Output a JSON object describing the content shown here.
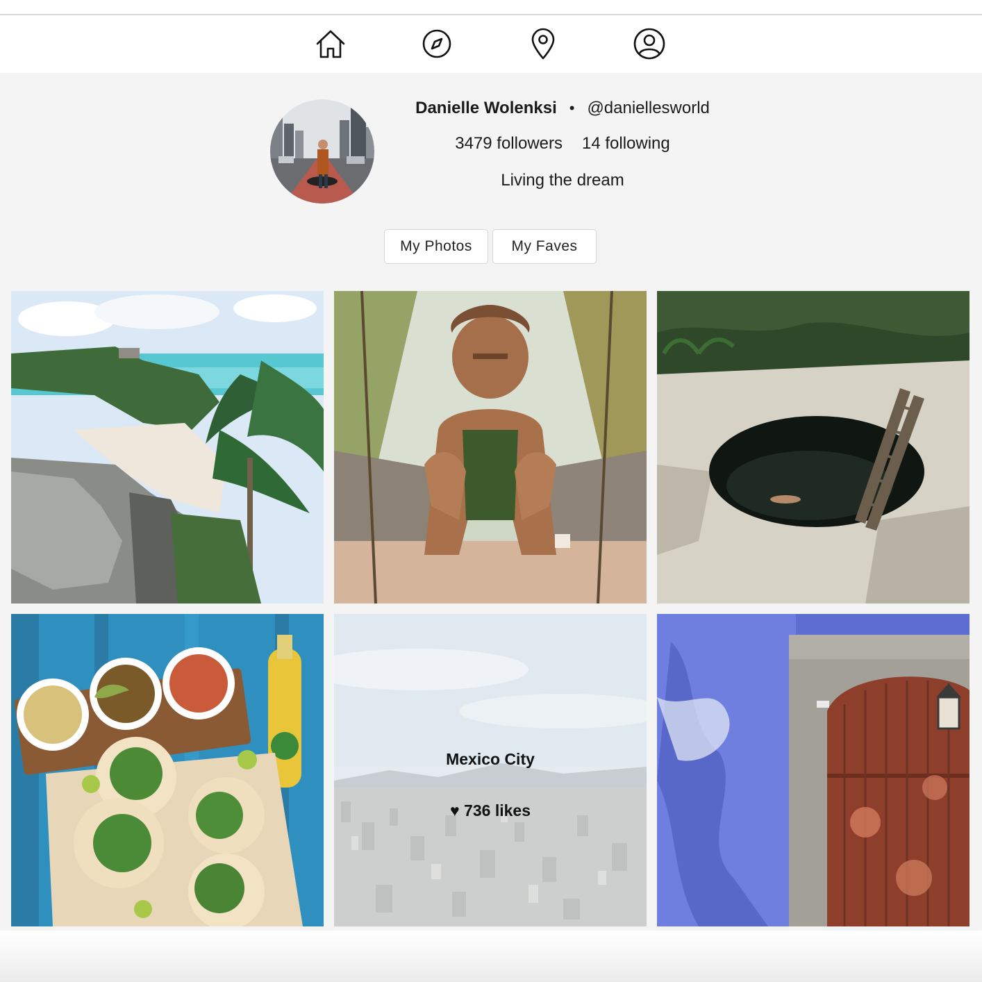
{
  "nav": {
    "items": [
      {
        "icon": "home-icon"
      },
      {
        "icon": "compass-icon"
      },
      {
        "icon": "map-pin-icon"
      },
      {
        "icon": "user-icon"
      }
    ]
  },
  "profile": {
    "name": "Danielle Wolenksi",
    "separator": "•",
    "handle": "@daniellesworld",
    "followers": "3479 followers",
    "following": "14 following",
    "bio": "Living the dream"
  },
  "tabs": {
    "photos_label": "My Photos",
    "faves_label": "My Faves"
  },
  "grid": {
    "hover_tile": {
      "title": "Mexico City",
      "likes": "♥ 736 likes"
    }
  },
  "colors": {
    "text": "#1a1a1a",
    "background": "#f4f4f4",
    "nav_background": "#ffffff"
  }
}
